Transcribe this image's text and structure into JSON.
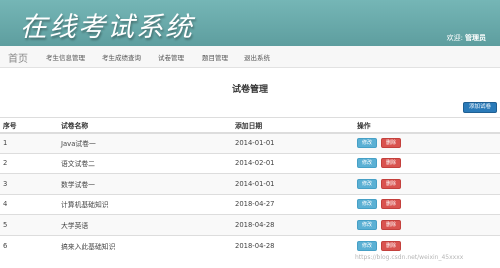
{
  "header": {
    "app_title": "在线考试系统",
    "welcome_label": "欢迎:",
    "user_name": "管理员"
  },
  "nav": {
    "brand": "首页",
    "items": [
      {
        "label": "考生信息管理"
      },
      {
        "label": "考生成绩查询"
      },
      {
        "label": "试卷管理"
      },
      {
        "label": "题目管理"
      },
      {
        "label": "退出系统"
      }
    ]
  },
  "main": {
    "page_title": "试卷管理",
    "add_button_label": "添加试卷",
    "columns": [
      "序号",
      "试卷名称",
      "添加日期",
      "操作"
    ],
    "edit_label": "修改",
    "delete_label": "删除",
    "rows": [
      {
        "index": "1",
        "name": "Java试卷一",
        "date": "2014-01-01"
      },
      {
        "index": "2",
        "name": "语文试卷二",
        "date": "2014-02-01"
      },
      {
        "index": "3",
        "name": "数学试卷一",
        "date": "2014-01-01"
      },
      {
        "index": "4",
        "name": "计算机基础知识",
        "date": "2018-04-27"
      },
      {
        "index": "5",
        "name": "大学英语",
        "date": "2018-04-28"
      },
      {
        "index": "6",
        "name": "搞来入此基础知识",
        "date": "2018-04-28"
      }
    ]
  },
  "watermark": "https://blog.csdn.net/weixin_45xxxx"
}
